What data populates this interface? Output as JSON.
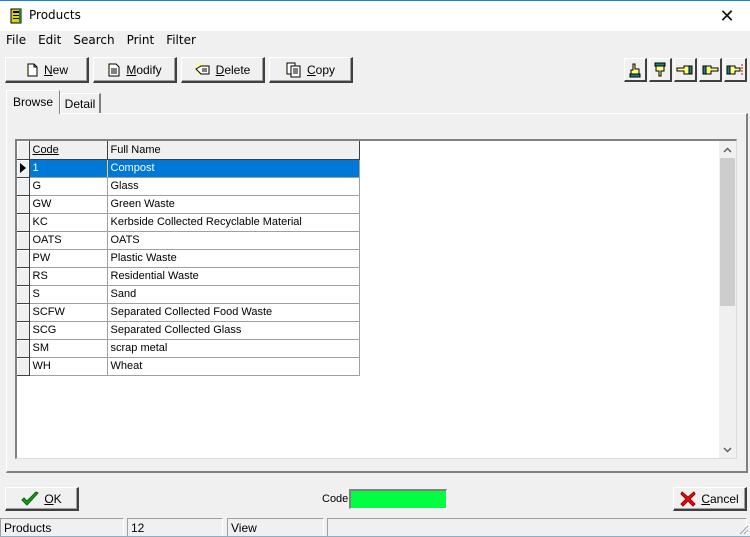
{
  "window": {
    "title": "Products",
    "close_glyph": "✕"
  },
  "menu": [
    "File",
    "Edit",
    "Search",
    "Print",
    "Filter"
  ],
  "toolbar": {
    "buttons": [
      {
        "label_hot": "N",
        "label_rest": "ew",
        "icon": "new-document-icon"
      },
      {
        "label_hot": "M",
        "label_rest": "odify",
        "icon": "modify-document-icon"
      },
      {
        "label_hot": "D",
        "label_rest": "elete",
        "icon": "delete-icon"
      },
      {
        "label_hot": "C",
        "label_rest": "opy",
        "icon": "copy-icon"
      }
    ],
    "nav_icons": [
      "first-record-icon",
      "last-record-icon",
      "previous-record-icon",
      "next-record-icon",
      "next-page-record-icon"
    ]
  },
  "tabs": [
    {
      "label": "Browse",
      "active": true
    },
    {
      "label": "Detail",
      "active": false
    }
  ],
  "grid": {
    "columns": [
      "Code",
      "Full Name"
    ],
    "selected_index": 0,
    "rows": [
      {
        "code": "1",
        "name": "Compost"
      },
      {
        "code": "G",
        "name": "Glass"
      },
      {
        "code": "GW",
        "name": "Green Waste"
      },
      {
        "code": "KC",
        "name": "Kerbside Collected Recyclable Material"
      },
      {
        "code": "OATS",
        "name": "OATS"
      },
      {
        "code": "PW",
        "name": "Plastic Waste"
      },
      {
        "code": "RS",
        "name": "Residential Waste"
      },
      {
        "code": "S",
        "name": "Sand"
      },
      {
        "code": "SCFW",
        "name": "Separated Collected Food Waste"
      },
      {
        "code": "SCG",
        "name": "Separated Collected Glass"
      },
      {
        "code": "SM",
        "name": "scrap metal"
      },
      {
        "code": "WH",
        "name": "Wheat"
      }
    ]
  },
  "footer": {
    "ok_hot": "O",
    "ok_rest": "K",
    "cancel_hot": "C",
    "cancel_rest": "ancel",
    "code_label": "Code",
    "code_value": "",
    "code_field_color": "#00ff40"
  },
  "status": {
    "table": "Products",
    "count": "12",
    "mode": "View",
    "extra": ""
  },
  "colors": {
    "selection": "#0078d7",
    "face": "#f0f0f0"
  }
}
